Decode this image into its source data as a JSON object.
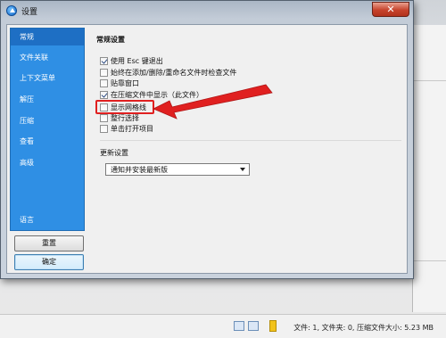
{
  "dialog": {
    "title": "设置",
    "close_label": "✕"
  },
  "sidebar": {
    "items": [
      {
        "label": "常规",
        "active": true
      },
      {
        "label": "文件关联",
        "active": false
      },
      {
        "label": "上下文菜单",
        "active": false
      },
      {
        "label": "解压",
        "active": false
      },
      {
        "label": "压缩",
        "active": false
      },
      {
        "label": "查看",
        "active": false
      },
      {
        "label": "高级",
        "active": false
      },
      {
        "label": "语言",
        "active": false
      }
    ]
  },
  "buttons": {
    "reset_label": "重置",
    "ok_label": "确定"
  },
  "general": {
    "section_title": "常规设置",
    "options": [
      {
        "label": "使用 Esc 键退出",
        "checked": true
      },
      {
        "label": "始终在添加/删除/重命名文件时检查文件",
        "checked": false
      },
      {
        "label": "贴靠窗口",
        "checked": false
      },
      {
        "label": "在压缩文件中显示（此文件）",
        "checked": true
      },
      {
        "label": "显示网格线",
        "checked": false
      },
      {
        "label": "整行选择",
        "checked": false
      },
      {
        "label": "单击打开项目",
        "checked": false
      }
    ]
  },
  "update": {
    "section_title": "更新设置",
    "selected_option": "通知并安装最新版"
  },
  "annotation": {
    "highlight_color": "#e02020"
  },
  "background": {
    "status_text": "文件: 1, 文件夹: 0, 压缩文件大小: 5.23 MB"
  }
}
